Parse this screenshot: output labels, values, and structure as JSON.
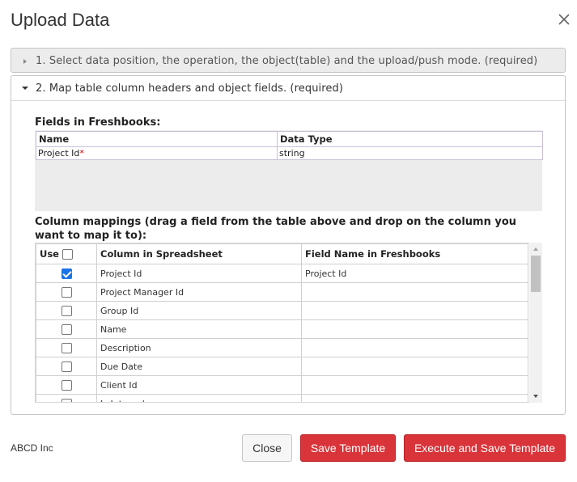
{
  "dialog": {
    "title": "Upload Data",
    "close_icon": "close-icon"
  },
  "steps": [
    {
      "label": "1. Select data position, the operation, the object(table) and the upload/push mode. (required)",
      "expanded": false
    },
    {
      "label": "2. Map table column headers and object fields. (required)",
      "expanded": true
    }
  ],
  "fields_section": {
    "title": "Fields in Freshbooks:",
    "columns": [
      "Name",
      "Data Type"
    ],
    "rows": [
      {
        "name": "Project Id",
        "required_mark": "*",
        "type": "string"
      }
    ]
  },
  "mappings_section": {
    "title": "Column mappings (drag a field from the table above and drop on the column you want to map it to):",
    "columns": {
      "use": "Use",
      "column": "Column in Spreadsheet",
      "field": "Field Name in Freshbooks"
    },
    "rows": [
      {
        "column": "Project Id",
        "field": "Project Id",
        "checked": true
      },
      {
        "column": "Project Manager Id",
        "field": "",
        "checked": false
      },
      {
        "column": "Group Id",
        "field": "",
        "checked": false
      },
      {
        "column": "Name",
        "field": "",
        "checked": false
      },
      {
        "column": "Description",
        "field": "",
        "checked": false
      },
      {
        "column": "Due Date",
        "field": "",
        "checked": false
      },
      {
        "column": "Client Id",
        "field": "",
        "checked": false
      },
      {
        "column": "Is Internal",
        "field": "",
        "checked": false
      }
    ]
  },
  "footer": {
    "company": "ABCD Inc",
    "close_label": "Close",
    "save_template_label": "Save Template",
    "execute_label": "Execute and Save Template"
  },
  "colors": {
    "primary_button": "#d9343a",
    "checkbox_checked": "#1a73e8"
  }
}
